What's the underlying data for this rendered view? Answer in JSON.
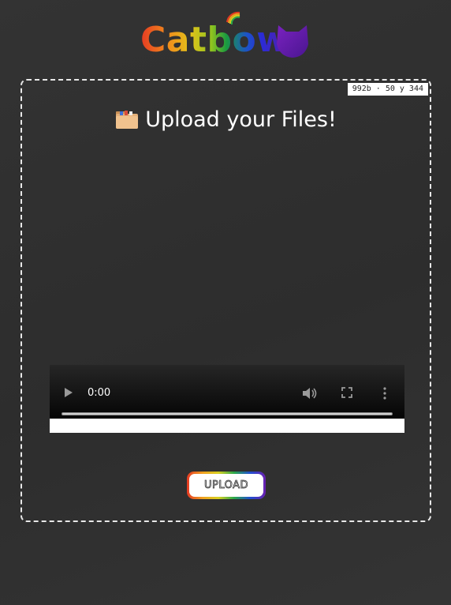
{
  "brand": {
    "name": "Catbow",
    "logo_colors": [
      "#e53923",
      "#f08a1c",
      "#e2c31a",
      "#8fc31f",
      "#1a9b3f",
      "#1d52c8",
      "#5a1fa3"
    ],
    "cat_icon": "cat-head-icon"
  },
  "upload_area": {
    "size_badge": "992b · 50 y 344",
    "heading": "Upload your Files!",
    "heading_icon": "file-folder-icon"
  },
  "video_player": {
    "time": "0:00",
    "icons": [
      "play-icon",
      "volume-icon",
      "fullscreen-icon",
      "more-options-icon"
    ]
  },
  "upload_button": {
    "label": "UPLOAD"
  }
}
